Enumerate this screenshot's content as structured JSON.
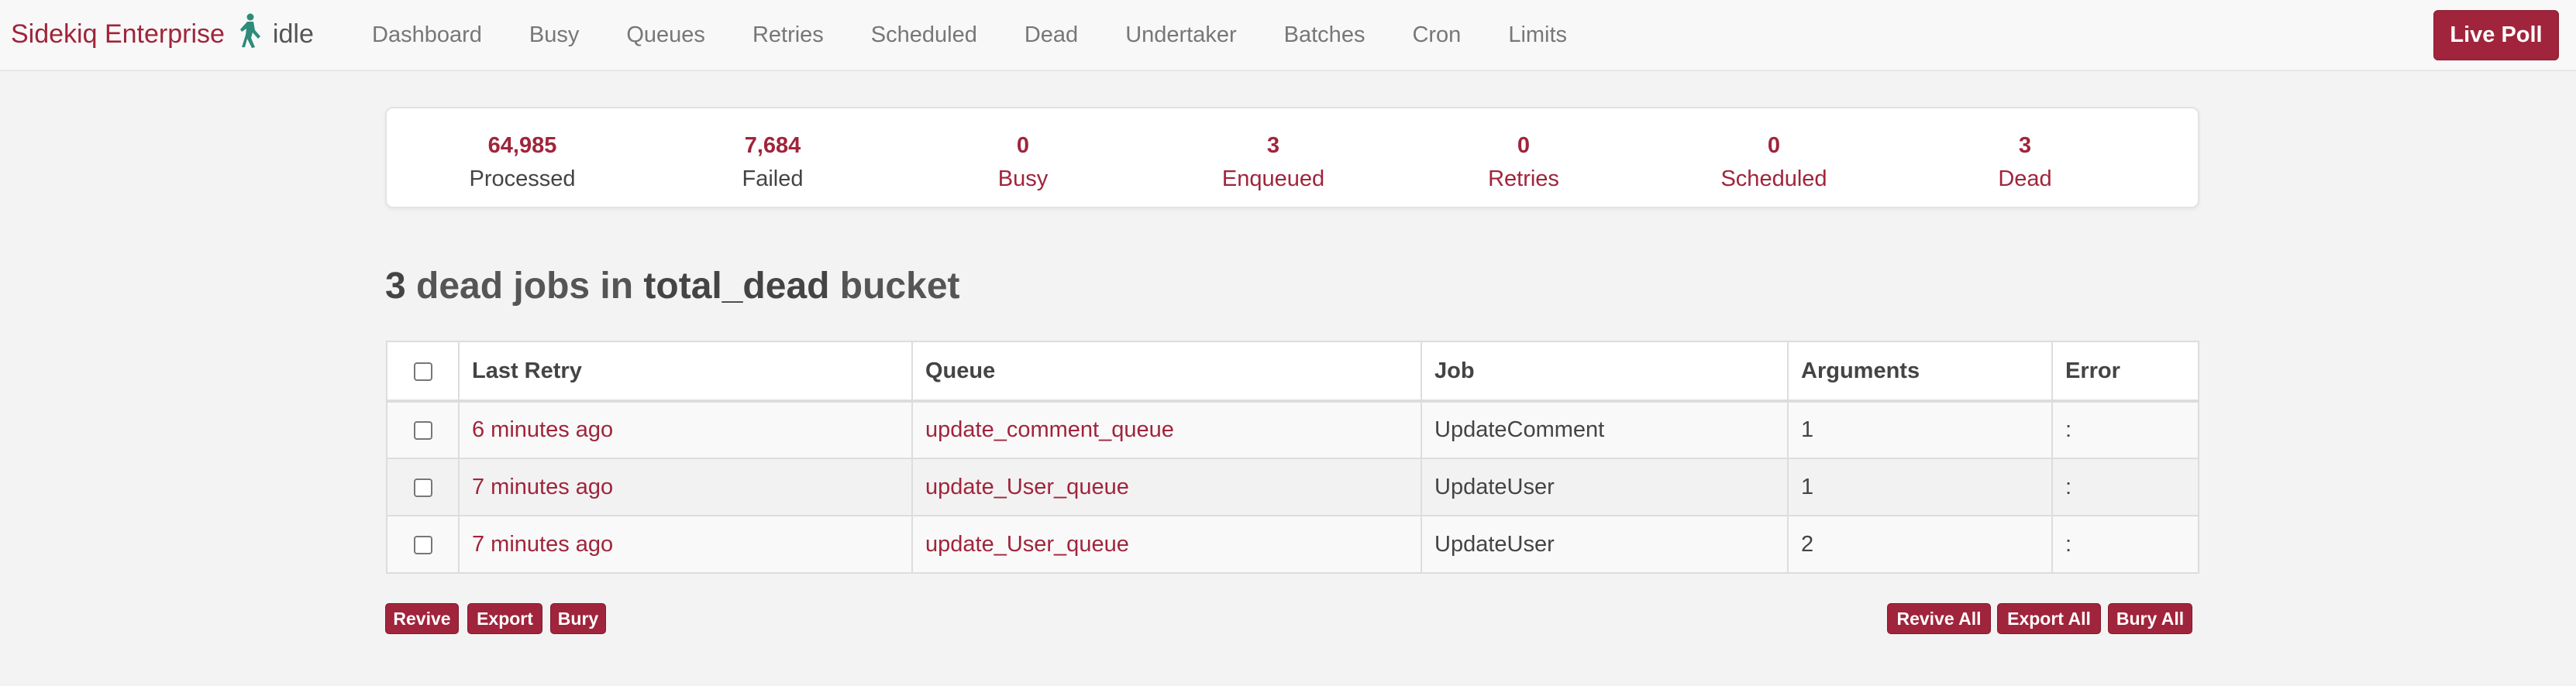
{
  "navbar": {
    "brand": "Sidekiq Enterprise",
    "status": "idle",
    "links": [
      "Dashboard",
      "Busy",
      "Queues",
      "Retries",
      "Scheduled",
      "Dead",
      "Undertaker",
      "Batches",
      "Cron",
      "Limits"
    ],
    "live_poll_label": "Live Poll"
  },
  "summary": [
    {
      "count": "64,985",
      "label": "Processed"
    },
    {
      "count": "7,684",
      "label": "Failed"
    },
    {
      "count": "0",
      "label": "Busy"
    },
    {
      "count": "3",
      "label": "Enqueued"
    },
    {
      "count": "0",
      "label": "Retries"
    },
    {
      "count": "0",
      "label": "Scheduled"
    },
    {
      "count": "3",
      "label": "Dead"
    }
  ],
  "heading": {
    "count": "3",
    "middle": " dead jobs in ",
    "bucket": "total_dead",
    "suffix": " bucket"
  },
  "table": {
    "headers": [
      "Last Retry",
      "Queue",
      "Job",
      "Arguments",
      "Error"
    ],
    "rows": [
      {
        "last_retry": "6 minutes ago",
        "queue": "update_comment_queue",
        "job": "UpdateComment",
        "arguments": "1",
        "error": ":"
      },
      {
        "last_retry": "7 minutes ago",
        "queue": "update_User_queue",
        "job": "UpdateUser",
        "arguments": "1",
        "error": ":"
      },
      {
        "last_retry": "7 minutes ago",
        "queue": "update_User_queue",
        "job": "UpdateUser",
        "arguments": "2",
        "error": ":"
      }
    ]
  },
  "actions": {
    "revive": "Revive",
    "export": "Export",
    "bury": "Bury",
    "revive_all": "Revive All",
    "export_all": "Export All",
    "bury_all": "Bury All"
  },
  "colors": {
    "accent": "#a0243b",
    "background": "#f3f3f3"
  }
}
